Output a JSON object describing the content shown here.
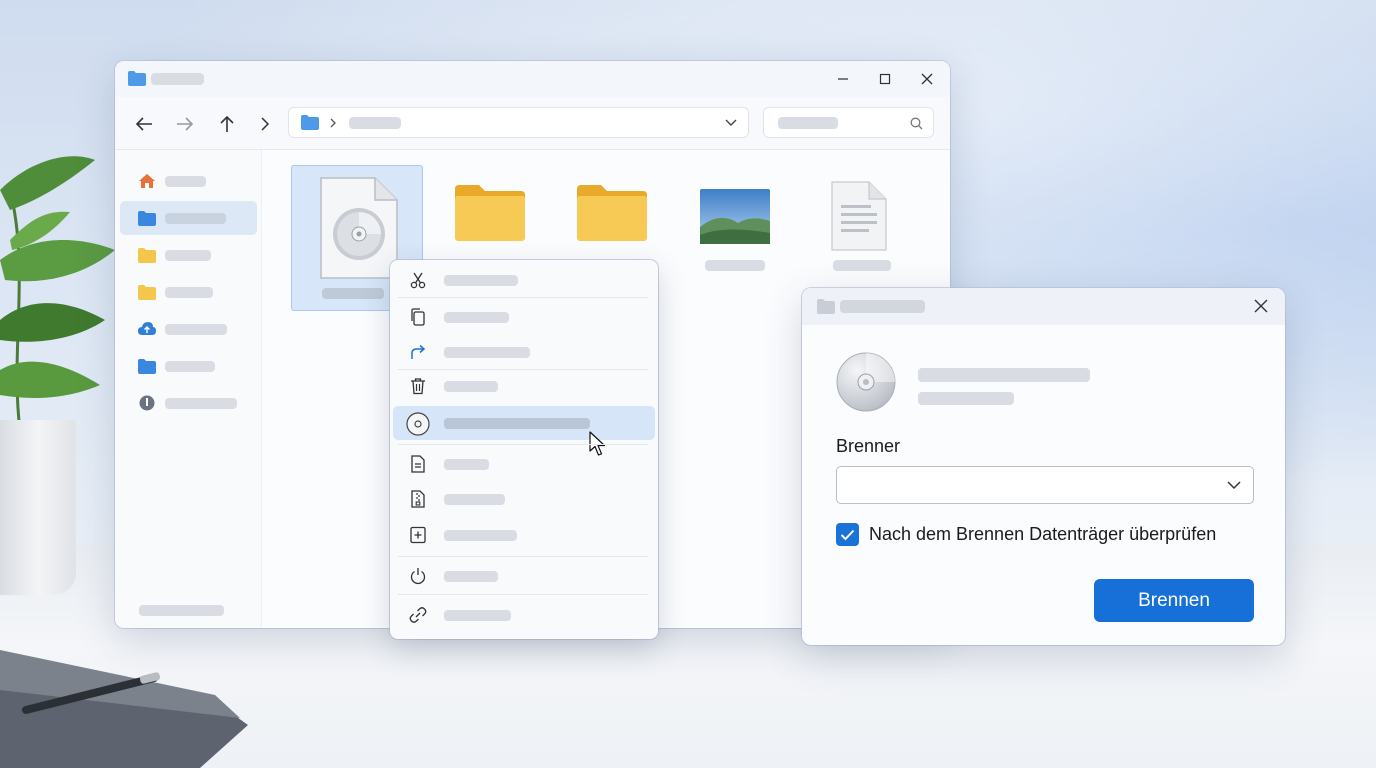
{
  "colors": {
    "accent": "#1670d8",
    "folder_blue": "#4f9ae8",
    "folder_yellow": "#f4c64c",
    "placeholder": "#d9dde3",
    "hover": "#d6e5f7"
  },
  "explorer": {
    "titlebar": {
      "icon": "folder-icon",
      "controls": [
        "minimize-icon",
        "maximize-icon",
        "close-icon"
      ]
    },
    "navbar": {
      "buttons": [
        "back-arrow-icon",
        "forward-arrow-icon",
        "up-arrow-icon",
        "chevron-right-icon"
      ],
      "address_icon": "folder-icon",
      "address_dropdown_icon": "chevron-down-icon",
      "search_icon": "search-icon"
    },
    "sidebar": {
      "items": [
        {
          "icon": "home-icon",
          "active": false
        },
        {
          "icon": "folder-icon",
          "active": true
        },
        {
          "icon": "folder-icon",
          "active": false
        },
        {
          "icon": "folder-icon",
          "active": false
        },
        {
          "icon": "cloud-icon",
          "active": false
        },
        {
          "icon": "folder-icon",
          "active": false
        },
        {
          "icon": "drive-icon",
          "active": false
        }
      ]
    },
    "files": [
      {
        "icon": "disc-image-file-icon",
        "selected": true
      },
      {
        "icon": "folder-icon",
        "selected": false
      },
      {
        "icon": "folder-icon",
        "selected": false
      },
      {
        "icon": "image-file-icon",
        "selected": false
      },
      {
        "icon": "document-file-icon",
        "selected": false
      }
    ]
  },
  "context_menu": {
    "items": [
      {
        "icon": "cut-icon"
      },
      {
        "icon": "copy-icon"
      },
      {
        "icon": "share-icon"
      },
      {
        "icon": "delete-icon"
      },
      {
        "icon": "disc-burn-icon",
        "hover": true
      },
      {
        "icon": "document-icon"
      },
      {
        "icon": "zip-file-icon"
      },
      {
        "icon": "add-file-icon"
      },
      {
        "icon": "power-icon"
      },
      {
        "icon": "link-icon"
      }
    ]
  },
  "burn_dialog": {
    "title_icon": "folder-icon",
    "close_icon": "close-icon",
    "disc_icon": "disc-icon",
    "burner_label": "Brenner",
    "burner_value": "",
    "verify_checked": true,
    "verify_label": "Nach dem Brennen Datenträger überprüfen",
    "burn_button": "Brennen"
  }
}
